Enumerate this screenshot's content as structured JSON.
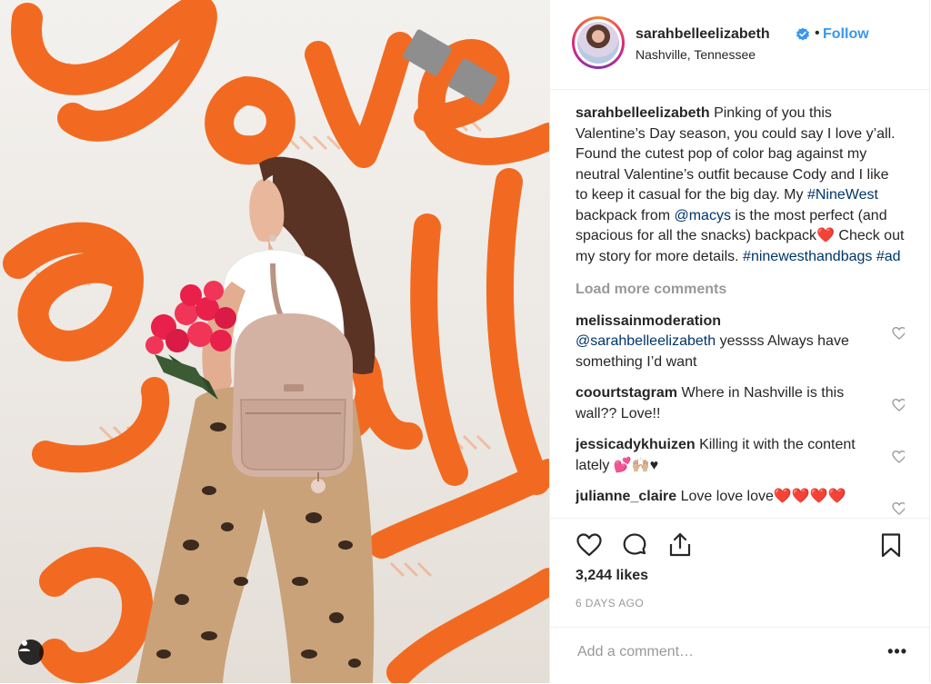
{
  "colors": {
    "accent": "#3897f0",
    "wall_orange": "#f26a21",
    "heart_red": "#e0245e"
  },
  "post": {
    "username": "sarahbelleelizabeth",
    "verified": true,
    "separator": "•",
    "follow_label": "Follow",
    "location": "Nashville, Tennessee"
  },
  "caption": {
    "username": "sarahbelleelizabeth",
    "text_1": " Pinking of you this Valentine’s Day season, you could say I love y’all. Found the cutest pop of color bag against my neutral Valentine’s outfit because Cody and I like to keep it casual for the big day. My ",
    "hashtag_1": "#NineWest",
    "text_2": " backpack from ",
    "mention_1": "@macys",
    "text_3": " is the most perfect (and spacious for all the snacks) backpack",
    "emoji_1": "❤️",
    "text_4": " Check out my story for more details. ",
    "hashtag_2": "#ninewesthandbags",
    "text_5": " ",
    "hashtag_3": "#ad"
  },
  "load_more_label": "Load more comments",
  "comments": [
    {
      "user": "melissainmoderation",
      "mention": "@sarahbelleelizabeth",
      "text": " yessss Always have something I’d want"
    },
    {
      "user": "coourtstagram",
      "text": " Where in Nashville is this wall?? Love!!"
    },
    {
      "user": "jessicadykhuizen",
      "text": " Killing it with the content lately 💕🙌🏼♥"
    },
    {
      "user": "julianne_claire",
      "text": " Love love love❤️❤️❤️❤️"
    }
  ],
  "actions": {
    "like_icon": "heart-icon",
    "comment_icon": "comment-icon",
    "share_icon": "share-icon",
    "save_icon": "bookmark-icon"
  },
  "likes": "3,244 likes",
  "timestamp": "6 DAYS AGO",
  "add_comment_placeholder": "Add a comment…",
  "more_label": "•••",
  "photo": {
    "alt": "Woman with pink backpack and roses in front of Love Y'all mural",
    "tag_icon": "user-tag-icon"
  }
}
